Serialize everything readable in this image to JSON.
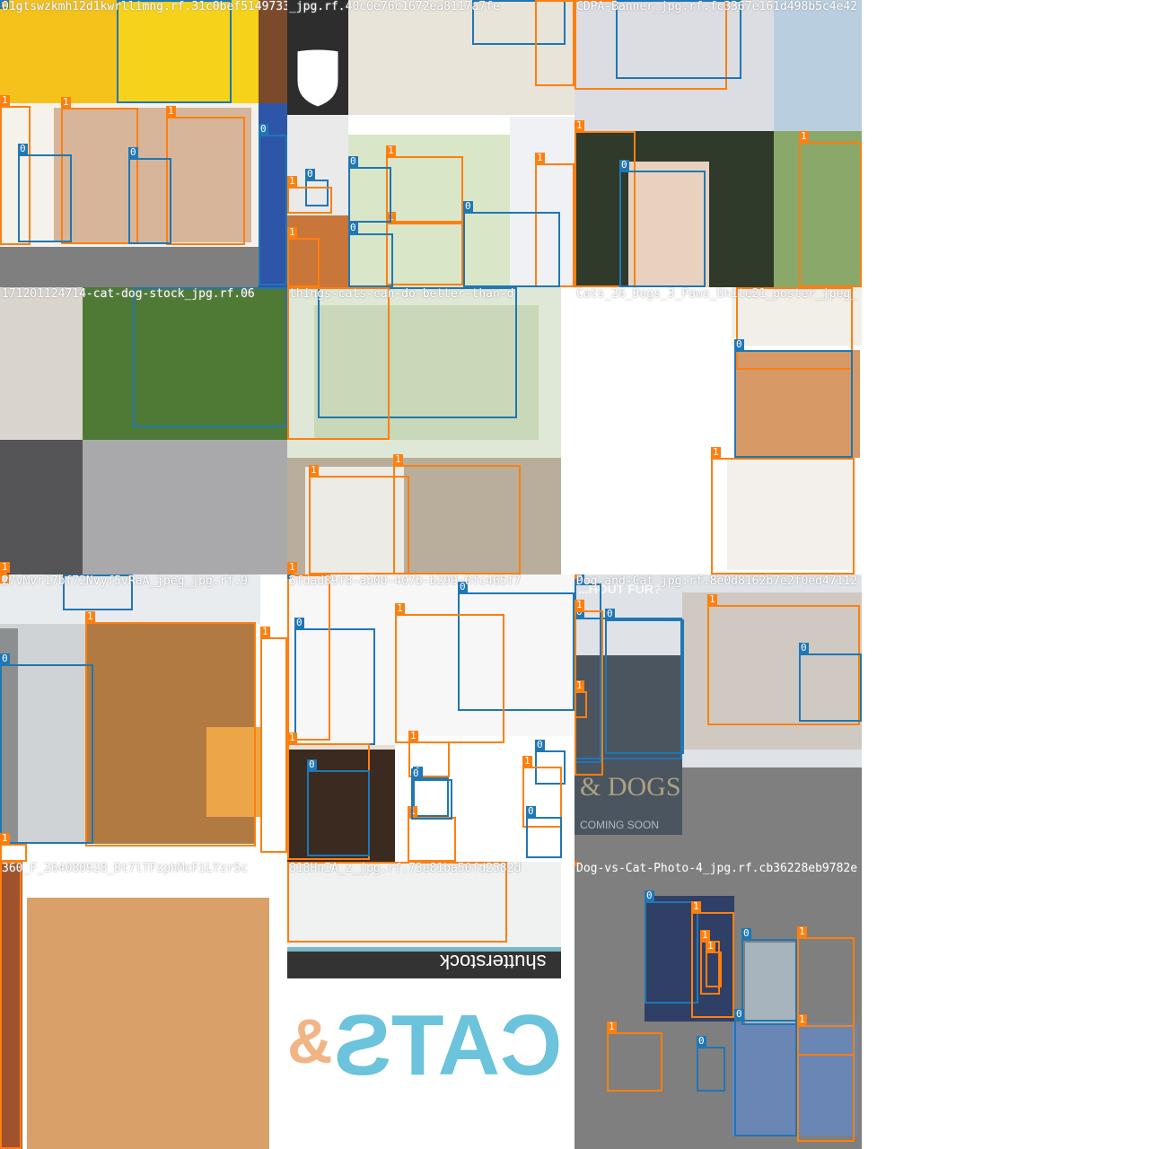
{
  "colors": {
    "cat_box": "#1f77b4",
    "dog_box": "#ff7f0e"
  },
  "classes": {
    "cat": "0",
    "dog": "1"
  },
  "tiles": [
    {
      "title": "01gtswzkmh12d1kwrllimng.rf.31c0bef51497333",
      "regions": [
        {
          "k": "a",
          "c": "#f4c21a"
        },
        {
          "k": "b",
          "c": "#f6d31a"
        },
        {
          "k": "c",
          "c": "#7a4a2a"
        },
        {
          "k": "d",
          "c": "#f5f2ec"
        },
        {
          "k": "e",
          "c": "#d7b59a"
        },
        {
          "k": "f",
          "c": "#2e56a8"
        },
        {
          "k": "g",
          "c": "#7f7f7f"
        }
      ],
      "boxes": [
        {
          "cls": "dog",
          "k": "t0d1"
        },
        {
          "cls": "dog",
          "k": "t0d2"
        },
        {
          "cls": "dog",
          "k": "t0d3"
        },
        {
          "cls": "dog",
          "k": "t0d4"
        },
        {
          "cls": "cat",
          "k": "t0c1"
        },
        {
          "cls": "cat",
          "k": "t0c2"
        },
        {
          "cls": "cat",
          "k": "t0c3"
        },
        {
          "cls": "cat",
          "k": "t0c4"
        },
        {
          "cls": "cat",
          "k": "t0c5"
        }
      ]
    },
    {
      "title": "_jpg.rf.40c0e76c1672ea8117a7fe",
      "regions": [
        {
          "k": "a",
          "c": "#2d2d2d"
        },
        {
          "k": "b",
          "c": "#e9e4da"
        },
        {
          "k": "c",
          "c": "#eaeaea"
        },
        {
          "k": "d",
          "c": "#d9e6c8"
        },
        {
          "k": "e",
          "c": "#f0f1f5"
        },
        {
          "k": "f",
          "c": "#c8763a"
        }
      ],
      "boxes": [
        {
          "cls": "cat",
          "k": "t1c1"
        },
        {
          "cls": "dog",
          "k": "t1d1"
        },
        {
          "cls": "dog",
          "k": "t1d2"
        },
        {
          "cls": "dog",
          "k": "t1d3"
        },
        {
          "cls": "cat",
          "k": "t1c2"
        },
        {
          "cls": "cat",
          "k": "t1c3"
        },
        {
          "cls": "cat",
          "k": "t1c4"
        },
        {
          "cls": "dog",
          "k": "t1d4"
        },
        {
          "cls": "dog",
          "k": "t1d5"
        },
        {
          "cls": "cat",
          "k": "t1c5"
        },
        {
          "cls": "dog",
          "k": "t1d6"
        }
      ]
    },
    {
      "title": "CDPA-Banner_jpg.rf.fc3367e161d498b5c4e42",
      "regions": [
        {
          "k": "a",
          "c": "#dcdde2"
        },
        {
          "k": "b",
          "c": "#b9cfe0"
        },
        {
          "k": "c",
          "c": "#2f3a2b"
        },
        {
          "k": "d",
          "c": "#8aa86a"
        },
        {
          "k": "e",
          "c": "#e8d2bf"
        }
      ],
      "boxes": [
        {
          "cls": "dog",
          "k": "t2d1"
        },
        {
          "cls": "cat",
          "k": "t2c1"
        },
        {
          "cls": "dog",
          "k": "t2d2"
        },
        {
          "cls": "cat",
          "k": "t2c2"
        },
        {
          "cls": "dog",
          "k": "t2d3"
        }
      ]
    },
    {
      "title": "171201124714-cat-dog-stock_jpg.rf.06",
      "regions": [
        {
          "k": "a",
          "c": "#d9d5ce"
        },
        {
          "k": "b",
          "c": "#4f7a36"
        },
        {
          "k": "c",
          "c": "#555557"
        },
        {
          "k": "d",
          "c": "#a9a9ab"
        }
      ],
      "boxes": [
        {
          "cls": "cat",
          "k": "t3c1"
        },
        {
          "cls": "dog",
          "k": "t3d1"
        }
      ]
    },
    {
      "title": "things-cats-can-do-better-than-d",
      "regions": [
        {
          "k": "a",
          "c": "#dfe7d6"
        },
        {
          "k": "b",
          "c": "#c9d8b8"
        },
        {
          "k": "c",
          "c": "#b9ae9b"
        },
        {
          "k": "d",
          "c": "#ecebe6"
        }
      ],
      "boxes": [
        {
          "cls": "cat",
          "k": "t4c1"
        },
        {
          "cls": "dog",
          "k": "t4d1"
        },
        {
          "cls": "dog",
          "k": "t4d2"
        },
        {
          "cls": "dog",
          "k": "t4d3"
        },
        {
          "cls": "dog",
          "k": "t4d4"
        }
      ]
    },
    {
      "title": "Cats_26_Dogs_3_Paws_Unite21_poster_jpeg_",
      "regions": [
        {
          "k": "a",
          "c": "#ffffff"
        },
        {
          "k": "b",
          "c": "#f2eee8"
        },
        {
          "k": "c",
          "c": "#d79a66"
        },
        {
          "k": "d",
          "c": "#f3efea"
        }
      ],
      "boxes": [
        {
          "cls": "dog",
          "k": "t5d1"
        },
        {
          "cls": "cat",
          "k": "t5c1"
        },
        {
          "cls": "dog",
          "k": "t5d2"
        }
      ]
    },
    {
      "title": "27vMvr17bf72Nvyf5vRaA_jpeg_jpg.rf.9",
      "regions": [
        {
          "k": "a",
          "c": "#e9ecef"
        },
        {
          "k": "b",
          "c": "#cfd3d6"
        },
        {
          "k": "c",
          "c": "#8b8f8f"
        },
        {
          "k": "d",
          "c": "#b07a42"
        },
        {
          "k": "e",
          "c": "#eda647"
        }
      ],
      "boxes": [
        {
          "cls": "cat",
          "k": "t6c1"
        },
        {
          "cls": "dog",
          "k": "t6d1"
        },
        {
          "cls": "dog",
          "k": "t6d2"
        },
        {
          "cls": "cat",
          "k": "t6c2"
        },
        {
          "cls": "dog",
          "k": "t6d3"
        },
        {
          "cls": "dog",
          "k": "t6d4"
        }
      ]
    },
    {
      "title": "5fdad89f8-ab00-407b-b299-0fc465f7",
      "regions": [
        {
          "k": "a",
          "c": "#f7f7f7"
        },
        {
          "k": "b",
          "c": "#e7e0d4"
        },
        {
          "k": "c",
          "c": "#3a2a20"
        },
        {
          "k": "d",
          "c": "#ffffff"
        }
      ],
      "boxes": [
        {
          "cls": "cat",
          "k": "t7c1"
        },
        {
          "cls": "dog",
          "k": "t7d1"
        },
        {
          "cls": "cat",
          "k": "t7c2"
        },
        {
          "cls": "dog",
          "k": "t7d2"
        },
        {
          "cls": "dog",
          "k": "t7d3"
        },
        {
          "cls": "cat",
          "k": "t7c3"
        },
        {
          "cls": "dog",
          "k": "t7d4"
        },
        {
          "cls": "cat",
          "k": "t7c4"
        },
        {
          "cls": "cat",
          "k": "t7c5"
        },
        {
          "cls": "dog",
          "k": "t7d5"
        },
        {
          "cls": "cat",
          "k": "t7c6"
        },
        {
          "cls": "dog",
          "k": "t7d6"
        },
        {
          "cls": "cat",
          "k": "t7c7"
        },
        {
          "cls": "dog",
          "k": "t7d7"
        },
        {
          "cls": "cat",
          "k": "t7c8"
        },
        {
          "cls": "cat",
          "k": "t7c9"
        }
      ]
    },
    {
      "title": "Dog-and-Cat_jpg.rf.8e0d8162b7e2f0ed47112",
      "regions": [
        {
          "k": "a",
          "c": "#dfe3e8"
        },
        {
          "k": "b",
          "c": "#7f7f7f"
        },
        {
          "k": "c",
          "c": "#4a5560"
        },
        {
          "k": "d",
          "c": "#cfc9c2"
        }
      ],
      "poster_text": {
        "q": "...HOUT FUR?",
        "name": "& DOGS",
        "soon": "COMING SOON"
      },
      "boxes": [
        {
          "cls": "dog",
          "k": "t8d1"
        },
        {
          "cls": "cat",
          "k": "t8c1"
        },
        {
          "cls": "cat",
          "k": "t8c2"
        },
        {
          "cls": "cat",
          "k": "t8c3"
        },
        {
          "cls": "cat",
          "k": "t8c4"
        },
        {
          "cls": "dog",
          "k": "t8d2"
        },
        {
          "cls": "dog",
          "k": "t8d3"
        },
        {
          "cls": "dog",
          "k": "t8d4"
        }
      ]
    },
    {
      "title": "360_F_264080928_Dt7lTFzphMcFiLYzrSc",
      "regions": [
        {
          "k": "a",
          "c": "#a0522d"
        },
        {
          "k": "b",
          "c": "#ffffff"
        },
        {
          "k": "c",
          "c": "#d9a06a"
        }
      ],
      "boxes": [
        {
          "cls": "dog",
          "k": "t9d1"
        }
      ]
    },
    {
      "title": "818HnIA_z_jpg.rf.73e81ba50fd2582d",
      "regions": [
        {
          "k": "a",
          "c": "#f0f1f1"
        },
        {
          "k": "b",
          "c": "#7cb8c6"
        },
        {
          "k": "c",
          "c": "#333333"
        },
        {
          "k": "d",
          "c": "#ffffff"
        }
      ],
      "texts": {
        "brand": "shutterstock",
        "cats": "CATS",
        "amp": "&"
      },
      "boxes": [
        {
          "cls": "dog",
          "k": "t10d1"
        }
      ]
    },
    {
      "title": "Dog-vs-Cat-Photo-4_jpg.rf.cb36228eb9782e",
      "regions": [
        {
          "k": "a",
          "c": "#7f7f7f"
        },
        {
          "k": "b",
          "c": "#2f3f66"
        },
        {
          "k": "c",
          "c": "#a7b3bd"
        },
        {
          "k": "d",
          "c": "#6a86b5"
        }
      ],
      "boxes": [
        {
          "cls": "cat",
          "k": "t11c1"
        },
        {
          "cls": "dog",
          "k": "t11d1"
        },
        {
          "cls": "dog",
          "k": "t11d2"
        },
        {
          "cls": "dog",
          "k": "t11d3"
        },
        {
          "cls": "cat",
          "k": "t11c2"
        },
        {
          "cls": "dog",
          "k": "t11d4"
        },
        {
          "cls": "dog",
          "k": "t11d5"
        },
        {
          "cls": "cat",
          "k": "t11c3"
        },
        {
          "cls": "cat",
          "k": "t11c4"
        },
        {
          "cls": "dog",
          "k": "t11d6"
        },
        {
          "cls": "dog",
          "k": "t11d7"
        }
      ]
    }
  ]
}
